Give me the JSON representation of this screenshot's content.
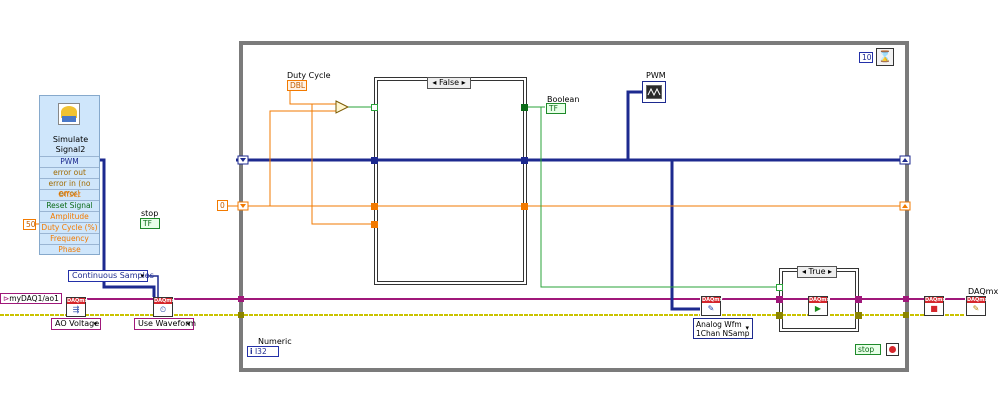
{
  "express_vi": {
    "title": "Simulate Signal2",
    "terminals": [
      {
        "label": "PWM",
        "color": "#1d2a8f"
      },
      {
        "label": "error out",
        "color": "#a06a00"
      },
      {
        "label": "error in (no error)",
        "color": "#a06a00"
      },
      {
        "label": "Offset",
        "color": "#f27a00"
      },
      {
        "label": "Reset Signal",
        "color": "#0b6b17"
      },
      {
        "label": "Amplitude",
        "color": "#f27a00"
      },
      {
        "label": "Duty Cycle (%)",
        "color": "#f27a00"
      },
      {
        "label": "Frequency",
        "color": "#f27a00"
      },
      {
        "label": "Phase",
        "color": "#f27a00"
      }
    ]
  },
  "constants": {
    "duty_in": "50",
    "init_value": "0",
    "wait_ms": "10",
    "channel": "myDAQ1/ao1"
  },
  "labels": {
    "stop_left": "stop",
    "duty_cycle": "Duty Cycle",
    "boolean": "Boolean",
    "pwm": "PWM",
    "numeric": "Numeric",
    "daqmx_cut": "DAQmx C"
  },
  "terminals": {
    "stop_left_type": "TF",
    "duty_cycle_type": "DBL",
    "boolean_type": "TF",
    "numeric_type": "I32",
    "stop_right": "stop"
  },
  "rings": {
    "sample_mode": "Continuous Samples",
    "ao_voltage": "AO Voltage",
    "use_waveform": "Use Waveform",
    "write_type_line1": "Analog Wfm",
    "write_type_line2": "1Chan NSamp"
  },
  "case_structures": {
    "inner_false": "False",
    "lower_true": "True"
  },
  "daqmx_header": "DAQmx",
  "wire_colors": {
    "waveform": "#1d2a8f",
    "numeric": "#f27a00",
    "boolean": "#2aa33a",
    "task": "#a0187a",
    "error": "#c9c200"
  }
}
